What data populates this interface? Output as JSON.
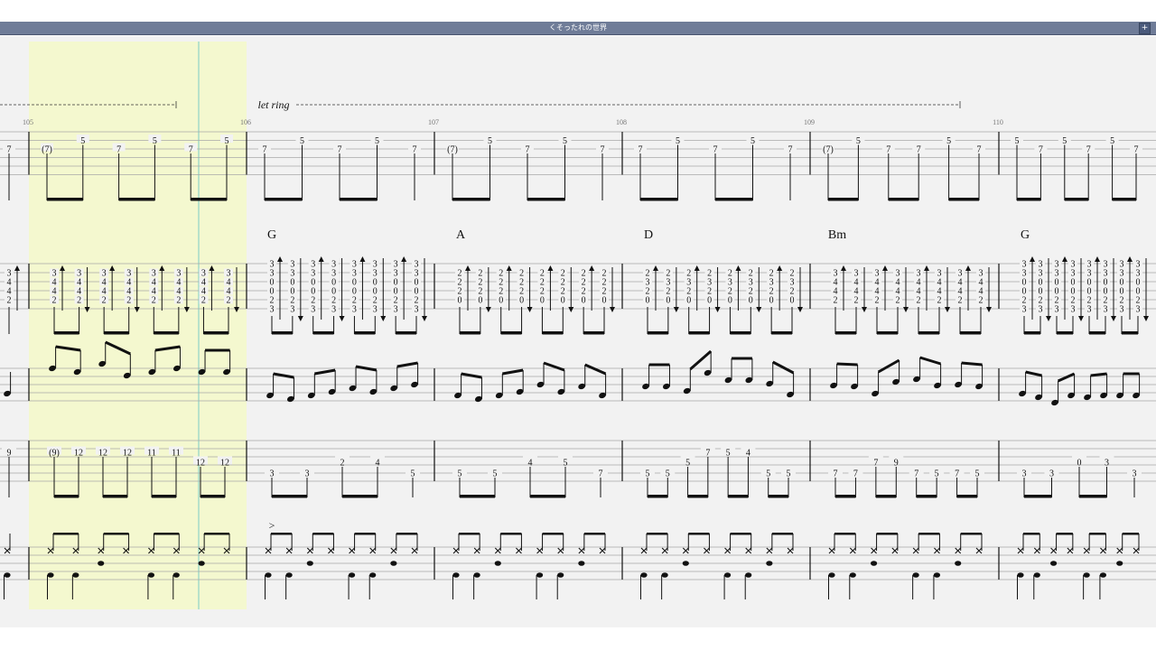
{
  "window": {
    "title": "くそったれの世界",
    "expand_button": "+"
  },
  "score": {
    "annotation": "let ring",
    "measure_numbers": [
      "105",
      "106",
      "107",
      "108",
      "109",
      "110"
    ],
    "chords": [
      "G",
      "A",
      "D",
      "Bm",
      "G"
    ],
    "lead_frets": [
      {
        "b": 0,
        "t": "7"
      },
      {
        "b": 1,
        "t": "(7)"
      },
      {
        "b": 1,
        "t": "5"
      },
      {
        "b": 1,
        "t": "7"
      },
      {
        "b": 1,
        "t": "5"
      },
      {
        "b": 1,
        "t": "7"
      },
      {
        "b": 1,
        "t": "5"
      },
      {
        "b": 2,
        "t": "7"
      },
      {
        "b": 2,
        "t": "5"
      },
      {
        "b": 2,
        "t": "7"
      },
      {
        "b": 2,
        "t": "5"
      },
      {
        "b": 2,
        "t": "7"
      },
      {
        "b": 3,
        "t": "(7)"
      },
      {
        "b": 3,
        "t": "5"
      },
      {
        "b": 3,
        "t": "7"
      },
      {
        "b": 3,
        "t": "5"
      },
      {
        "b": 3,
        "t": "7"
      },
      {
        "b": 4,
        "t": "7"
      },
      {
        "b": 4,
        "t": "5"
      },
      {
        "b": 4,
        "t": "7"
      },
      {
        "b": 4,
        "t": "5"
      },
      {
        "b": 4,
        "t": "7"
      },
      {
        "b": 5,
        "t": "(7)"
      },
      {
        "b": 5,
        "t": "5"
      },
      {
        "b": 5,
        "t": "7"
      },
      {
        "b": 5,
        "t": "7"
      },
      {
        "b": 5,
        "t": "5"
      },
      {
        "b": 5,
        "t": "7"
      },
      {
        "b": 6,
        "t": "5"
      },
      {
        "b": 6,
        "t": "7"
      },
      {
        "b": 6,
        "t": "5"
      },
      {
        "b": 6,
        "t": "7"
      },
      {
        "b": 6,
        "t": "5"
      },
      {
        "b": 6,
        "t": "7"
      }
    ],
    "strum_shapes": [
      {
        "b": 0,
        "frets": [
          "3",
          "4",
          "4",
          "2"
        ]
      },
      {
        "b": 1,
        "frets": [
          "3",
          "4",
          "4",
          "2"
        ]
      },
      {
        "b": 2,
        "frets": [
          "3",
          "3",
          "0",
          "0",
          "2",
          "3"
        ]
      },
      {
        "b": 3,
        "frets": [
          "2",
          "2",
          "2",
          "0"
        ]
      },
      {
        "b": 4,
        "frets": [
          "2",
          "3",
          "2",
          "0"
        ]
      },
      {
        "b": 5,
        "frets": [
          "3",
          "4",
          "4",
          "2"
        ]
      },
      {
        "b": 6,
        "frets": [
          "3",
          "3",
          "0",
          "0",
          "2",
          "3"
        ]
      }
    ],
    "bass_frets": [
      {
        "b": 0,
        "t": "9"
      },
      {
        "b": 1,
        "t": "(9)"
      },
      {
        "b": 1,
        "t": "12"
      },
      {
        "b": 1,
        "t": "12"
      },
      {
        "b": 1,
        "t": "12"
      },
      {
        "b": 1,
        "t": "11"
      },
      {
        "b": 1,
        "t": "11"
      },
      {
        "b": 1,
        "t": "12"
      },
      {
        "b": 1,
        "t": "12"
      },
      {
        "b": 2,
        "t": "3"
      },
      {
        "b": 2,
        "t": "3"
      },
      {
        "b": 2,
        "t": "2"
      },
      {
        "b": 2,
        "t": "4"
      },
      {
        "b": 2,
        "t": "5"
      },
      {
        "b": 3,
        "t": "5"
      },
      {
        "b": 3,
        "t": "5"
      },
      {
        "b": 3,
        "t": "4"
      },
      {
        "b": 3,
        "t": "5"
      },
      {
        "b": 3,
        "t": "7"
      },
      {
        "b": 4,
        "t": "5"
      },
      {
        "b": 4,
        "t": "5"
      },
      {
        "b": 4,
        "t": "5"
      },
      {
        "b": 4,
        "t": "7"
      },
      {
        "b": 4,
        "t": "5"
      },
      {
        "b": 4,
        "t": "4"
      },
      {
        "b": 4,
        "t": "5"
      },
      {
        "b": 4,
        "t": "5"
      },
      {
        "b": 5,
        "t": "7"
      },
      {
        "b": 5,
        "t": "7"
      },
      {
        "b": 5,
        "t": "7"
      },
      {
        "b": 5,
        "t": "9"
      },
      {
        "b": 5,
        "t": "7"
      },
      {
        "b": 5,
        "t": "5"
      },
      {
        "b": 5,
        "t": "7"
      },
      {
        "b": 5,
        "t": "5"
      },
      {
        "b": 6,
        "t": "3"
      },
      {
        "b": 6,
        "t": "3"
      },
      {
        "b": 6,
        "t": "0"
      },
      {
        "b": 6,
        "t": "3"
      },
      {
        "b": 6,
        "t": "3"
      }
    ],
    "accent_mark": ">",
    "colors": {
      "selection": "#f4f8cf",
      "playback_cursor": "#8fd3c8",
      "staff_line": "#a8a8a8",
      "titlebar": "#6f7c98",
      "canvas": "#f2f2f2"
    }
  }
}
